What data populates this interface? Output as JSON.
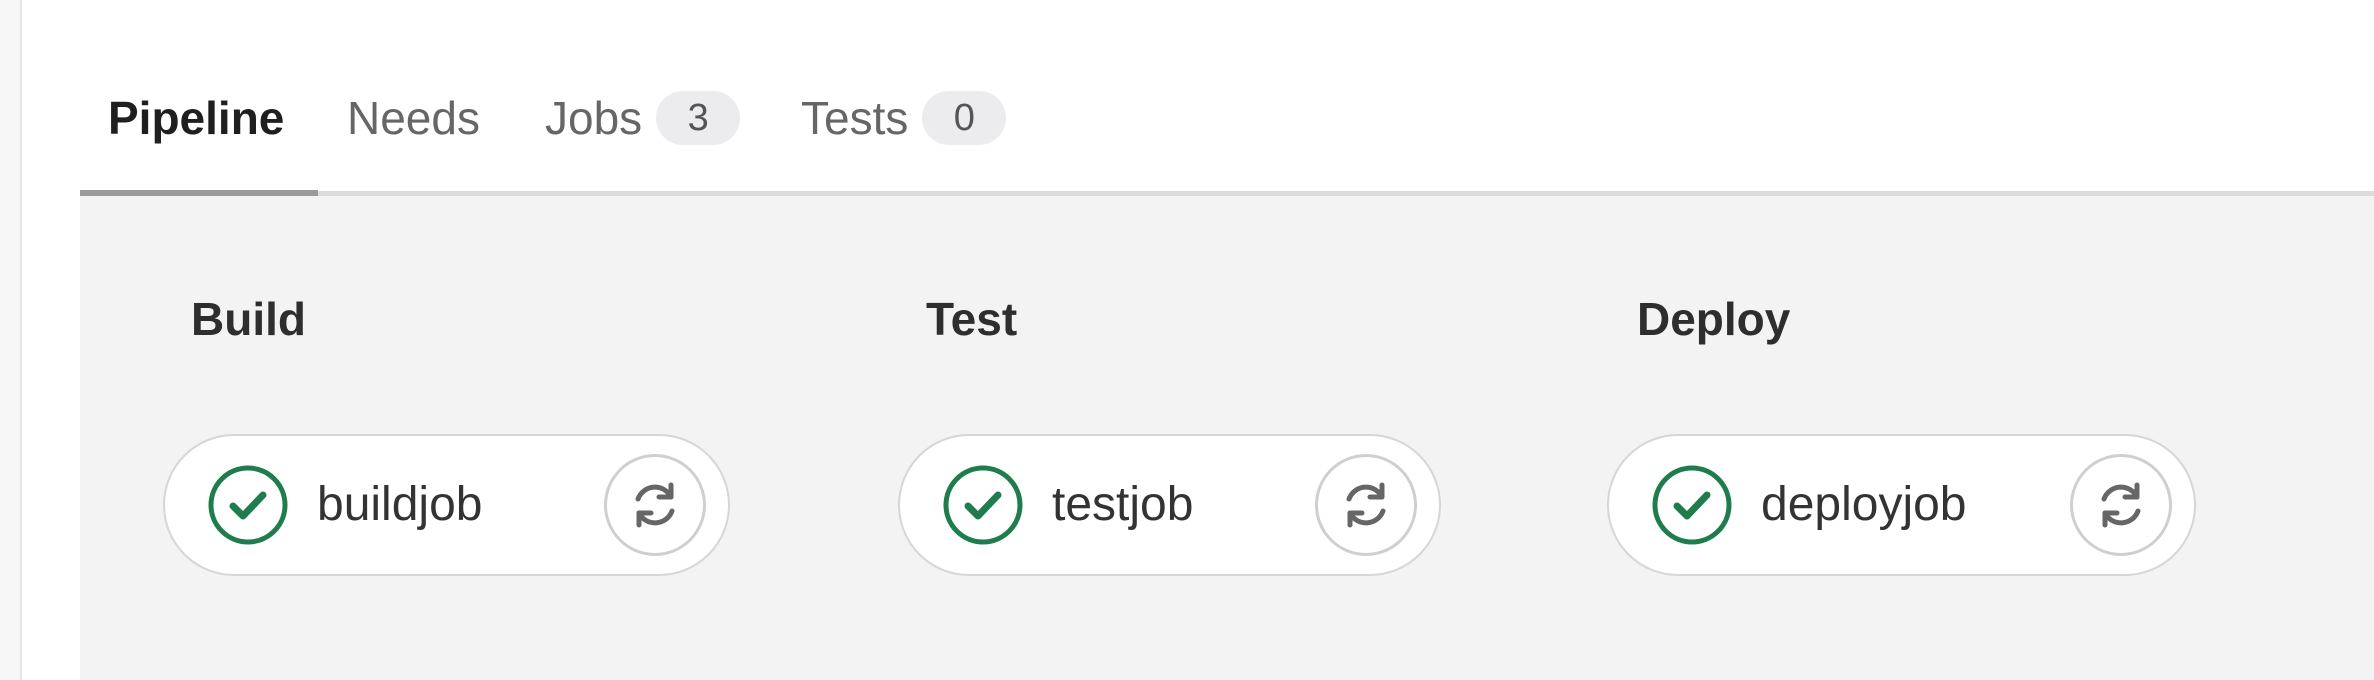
{
  "tabs": [
    {
      "label": "Pipeline",
      "active": true
    },
    {
      "label": "Needs",
      "active": false
    },
    {
      "label": "Jobs",
      "count": "3",
      "active": false
    },
    {
      "label": "Tests",
      "count": "0",
      "active": false
    }
  ],
  "stages": [
    {
      "title": "Build",
      "job": {
        "name": "buildjob",
        "status": "passed",
        "status_icon": "check-circle-icon",
        "action_icon": "retry-icon"
      }
    },
    {
      "title": "Test",
      "job": {
        "name": "testjob",
        "status": "passed",
        "status_icon": "check-circle-icon",
        "action_icon": "retry-icon"
      }
    },
    {
      "title": "Deploy",
      "job": {
        "name": "deployjob",
        "status": "passed",
        "status_icon": "check-circle-icon",
        "action_icon": "retry-icon"
      }
    }
  ],
  "colors": {
    "success": "#1f7d4d",
    "pipeline_background": "#f3f3f3",
    "tab_active_text": "#1f1f1f",
    "tab_inactive_text": "#666666"
  }
}
